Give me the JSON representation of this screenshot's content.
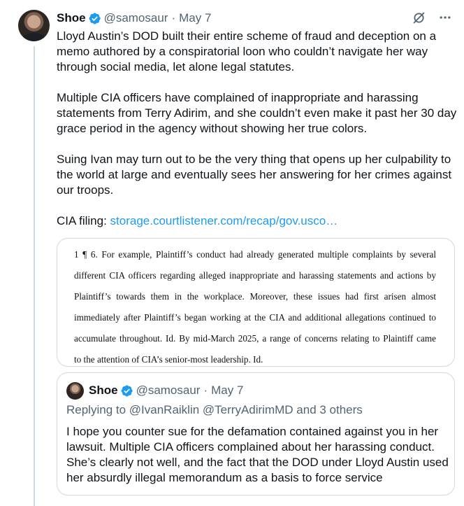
{
  "tweet": {
    "author_name": "Shoe",
    "handle": "@samosaur",
    "separator": "·",
    "date": "May 7",
    "paragraphs": [
      "Lloyd Austin’s DOD built their entire scheme of fraud and deception on a memo authored by a conspiratorial loon who couldn’t navigate her way through social media, let alone legal statutes.",
      "Multiple CIA officers have complained of inappropriate and harassing statements from Terry Adirim, and she couldn’t even make it past her 30 day grace period in the agency without showing her true colors.",
      "Suing Ivan may turn out to be the very thing that opens up her culpability to the world at large and eventually sees her answering for her crimes against our troops."
    ],
    "filing_label": "CIA filing: ",
    "filing_link": "storage.courtlistener.com/recap/gov.usco…"
  },
  "document_image": {
    "lines": [
      "1 ¶ 6.  For example, Plaintiff’s conduct had already generated multiple complaints by several",
      "different CIA officers regarding alleged inappropriate and harassing statements and actions by",
      "Plaintiff’s towards them in the workplace.  Moreover, these issues had first arisen almost",
      "immediately after Plaintiff’s began working at the CIA and additional allegations continued to",
      "accumulate throughout.  Id.  By mid-March 2025, a range of concerns relating to Plaintiff came",
      "to the attention of CIA’s senior-most leadership.  Id."
    ]
  },
  "quoted_tweet": {
    "author_name": "Shoe",
    "handle": "@samosaur",
    "separator": "·",
    "date": "May 7",
    "replying_to_label": "Replying to ",
    "replying_to_users": "@IvanRaiklin @TerryAdirimMD",
    "replying_to_and": " and ",
    "replying_to_others": "3 others",
    "text": "I hope you counter sue for the defamation contained against you in her lawsuit. Multiple CIA officers complained about her harassing conduct. She’s clearly not well, and the fact that the DOD under Lloyd Austin used her absurdly illegal memorandum as a basis to force service"
  },
  "icons": {
    "verified": "verified-badge-icon",
    "grok": "grok-icon",
    "more": "more-icon"
  },
  "colors": {
    "link": "#1d9bf0",
    "muted": "#536471",
    "border": "#cfd9de",
    "text": "#0f1419"
  }
}
